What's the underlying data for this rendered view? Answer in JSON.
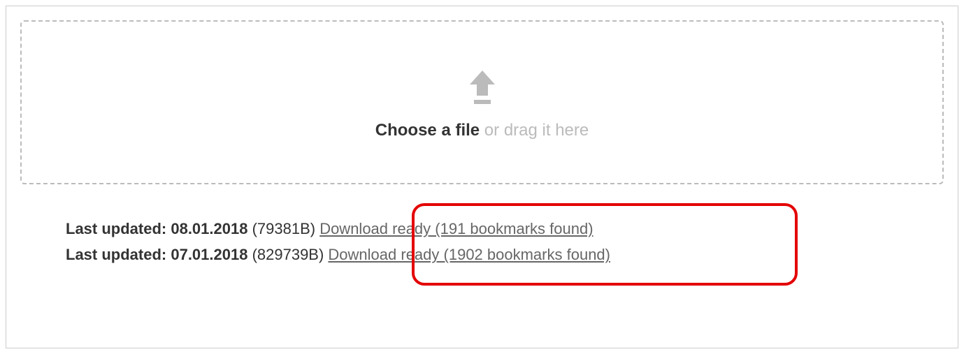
{
  "dropzone": {
    "choose_label": "Choose a file",
    "drag_hint": " or drag it here",
    "icon_name": "upload-icon"
  },
  "status": {
    "label": "Last updated: ",
    "rows": [
      {
        "date": "08.01.2018",
        "size": " (79381B) ",
        "download_text": "Download ready (191 bookmarks found)"
      },
      {
        "date": "07.01.2018",
        "size": " (829739B) ",
        "download_text": "Download ready (1902 bookmarks found)"
      }
    ]
  }
}
